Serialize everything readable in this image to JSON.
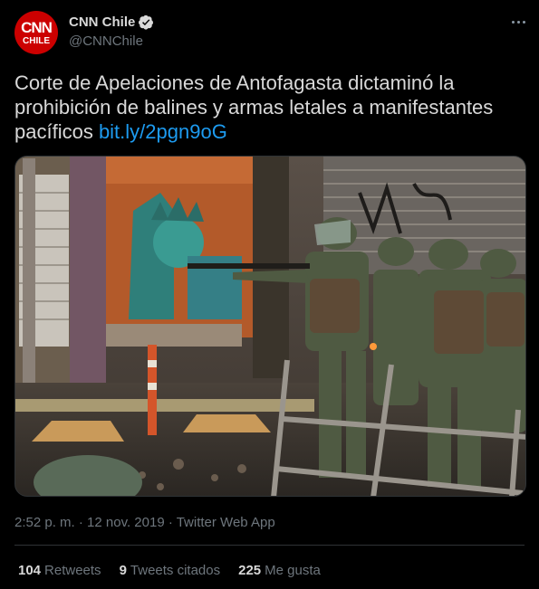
{
  "account": {
    "avatar_text_top": "CNN",
    "avatar_text_bottom": "CHILE",
    "display_name": "CNN Chile",
    "handle": "@CNNChile",
    "verified_icon": "verified-badge-icon",
    "more_icon": "more-options-icon"
  },
  "tweet": {
    "text": "Corte de Apelaciones de Antofagasta dictaminó la prohibición de balines y armas letales a manifestantes pacíficos ",
    "link": "bit.ly/2pgn9oG",
    "media_icon": "photo-riot-police-icon",
    "meta": "2:52 p. m. · 12 nov. 2019 · Twitter Web App"
  },
  "stats": {
    "retweets_count": "104",
    "retweets_label": "Retweets",
    "quotes_count": "9",
    "quotes_label": "Tweets citados",
    "likes_count": "225",
    "likes_label": "Me gusta"
  },
  "colors": {
    "background": "#000000",
    "link": "#1d9bf0",
    "secondary_text": "#6e767d",
    "avatar_brand": "#cc0000",
    "divider": "#2f3336"
  }
}
